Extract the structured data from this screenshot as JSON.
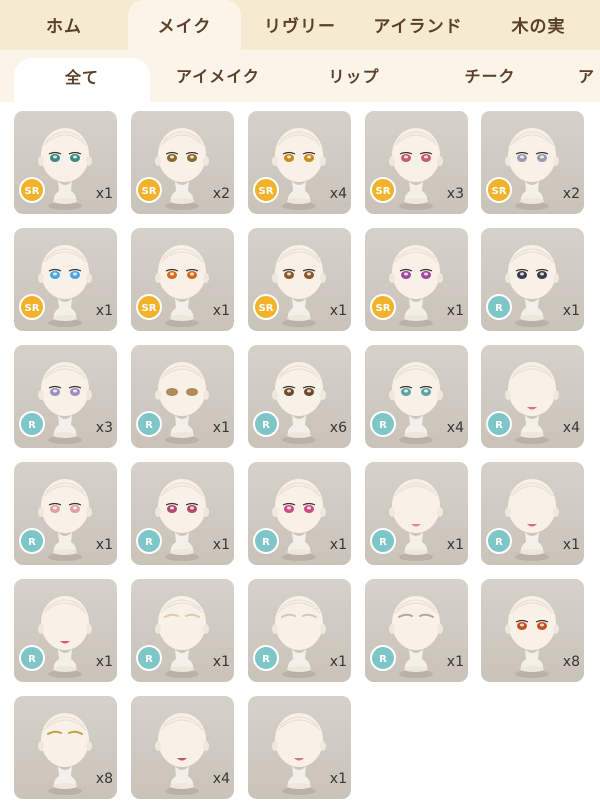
{
  "top_tabs": [
    "ホム",
    "メイク",
    "リヴリー",
    "アイランド",
    "木の実"
  ],
  "top_active": 1,
  "sub_tabs": [
    "全て",
    "アイメイク",
    "リップ",
    "チーク",
    "ア"
  ],
  "sub_active": 0,
  "items": [
    {
      "rarity": "SR",
      "count": "x1",
      "feature": "eyes",
      "color": "#3a8a86"
    },
    {
      "rarity": "SR",
      "count": "x2",
      "feature": "eyes",
      "color": "#8a6a2a"
    },
    {
      "rarity": "SR",
      "count": "x4",
      "feature": "eyes",
      "color": "#c98a1a"
    },
    {
      "rarity": "SR",
      "count": "x3",
      "feature": "eyes",
      "color": "#c0606a"
    },
    {
      "rarity": "SR",
      "count": "x2",
      "feature": "eyes",
      "color": "#9a9ab0"
    },
    {
      "rarity": "SR",
      "count": "x1",
      "feature": "eyes",
      "color": "#4aa6e0"
    },
    {
      "rarity": "SR",
      "count": "x1",
      "feature": "eyes",
      "color": "#d86a20"
    },
    {
      "rarity": "SR",
      "count": "x1",
      "feature": "eyes",
      "color": "#8a5a2a"
    },
    {
      "rarity": "SR",
      "count": "x1",
      "feature": "eyes",
      "color": "#a04aa0"
    },
    {
      "rarity": "R",
      "count": "x1",
      "feature": "eyes",
      "color": "#3a3a4a"
    },
    {
      "rarity": "R",
      "count": "x3",
      "feature": "eyes",
      "color": "#9a90c0"
    },
    {
      "rarity": "R",
      "count": "x1",
      "feature": "closed",
      "color": "#b08a5a"
    },
    {
      "rarity": "R",
      "count": "x6",
      "feature": "eyes",
      "color": "#6a4a2a"
    },
    {
      "rarity": "R",
      "count": "x4",
      "feature": "eyes",
      "color": "#60a0a8"
    },
    {
      "rarity": "R",
      "count": "x4",
      "feature": "mouth",
      "color": "#e07080"
    },
    {
      "rarity": "R",
      "count": "x1",
      "feature": "eyes",
      "color": "#e0a0a0"
    },
    {
      "rarity": "R",
      "count": "x1",
      "feature": "eyes",
      "color": "#b04a6a"
    },
    {
      "rarity": "R",
      "count": "x1",
      "feature": "eyes",
      "color": "#d04a8a"
    },
    {
      "rarity": "R",
      "count": "x1",
      "feature": "mouth",
      "color": "#e08a8a"
    },
    {
      "rarity": "R",
      "count": "x1",
      "feature": "mouth",
      "color": "#e06a6a"
    },
    {
      "rarity": "R",
      "count": "x1",
      "feature": "mouth",
      "color": "#e05a6a"
    },
    {
      "rarity": "R",
      "count": "x1",
      "feature": "brows",
      "color": "#e0c8a8"
    },
    {
      "rarity": "R",
      "count": "x1",
      "feature": "brows",
      "color": "#d0c8c8"
    },
    {
      "rarity": "R",
      "count": "x1",
      "feature": "brows",
      "color": "#b0a8a0"
    },
    {
      "rarity": "",
      "count": "x8",
      "feature": "eyes",
      "color": "#c85020"
    },
    {
      "rarity": "",
      "count": "x8",
      "feature": "brows",
      "color": "#c8a040"
    },
    {
      "rarity": "",
      "count": "x4",
      "feature": "mouth",
      "color": "#d04a6a"
    },
    {
      "rarity": "",
      "count": "x1",
      "feature": "mouth",
      "color": "#e07080"
    }
  ]
}
